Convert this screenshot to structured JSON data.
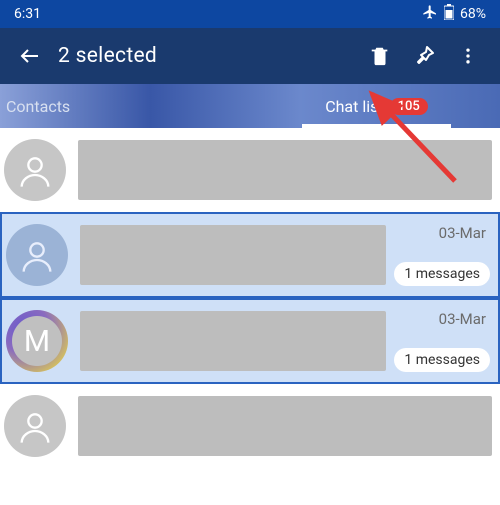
{
  "status": {
    "time": "6:31",
    "battery": "68%"
  },
  "appbar": {
    "title": "2 selected"
  },
  "tabs": {
    "contacts": "Contacts",
    "chatlist": "Chat list",
    "badge": "105"
  },
  "rows": [
    {
      "date": "",
      "count": "",
      "selected": false,
      "avatar": "person"
    },
    {
      "date": "03-Mar",
      "count": "1 messages",
      "selected": true,
      "avatar": "person"
    },
    {
      "date": "03-Mar",
      "count": "1 messages",
      "selected": true,
      "avatar": "M"
    },
    {
      "date": "",
      "count": "",
      "selected": false,
      "avatar": "person"
    }
  ],
  "colors": {
    "statusbar": "#0d47a1",
    "appbar": "#1a3a6e",
    "selection": "#cfe0f7",
    "badge": "#e53935",
    "arrow": "#e53935"
  }
}
